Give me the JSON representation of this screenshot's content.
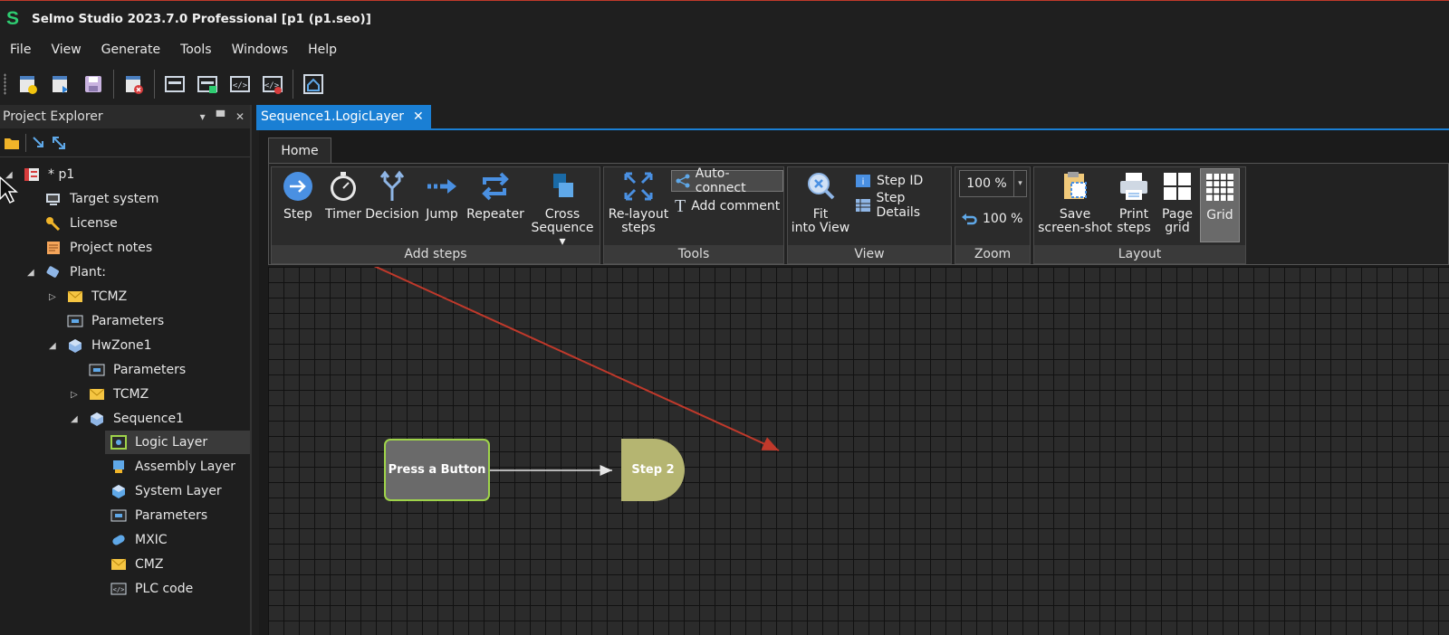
{
  "window": {
    "title": "Selmo Studio 2023.7.0 Professional  [p1 (p1.seo)]",
    "logo_text": "S"
  },
  "menu": [
    "File",
    "View",
    "Generate",
    "Tools",
    "Windows",
    "Help"
  ],
  "explorer": {
    "title": "Project Explorer",
    "tree": [
      {
        "label": "* p1",
        "icon": "project-icon",
        "expander": "◢"
      },
      {
        "label": "Target system",
        "icon": "target-system-icon",
        "expander": ""
      },
      {
        "label": "License",
        "icon": "key-icon",
        "expander": ""
      },
      {
        "label": "Project notes",
        "icon": "notes-icon",
        "expander": ""
      },
      {
        "label": "Plant:",
        "icon": "plant-icon",
        "expander": "◢"
      },
      {
        "label": "TCMZ",
        "icon": "envelope-icon",
        "expander": "▷"
      },
      {
        "label": "Parameters",
        "icon": "parameters-icon",
        "expander": ""
      },
      {
        "label": "HwZone1",
        "icon": "cube-icon",
        "expander": "◢"
      },
      {
        "label": "Parameters",
        "icon": "parameters-icon",
        "expander": ""
      },
      {
        "label": "TCMZ",
        "icon": "envelope-icon",
        "expander": "▷"
      },
      {
        "label": "Sequence1",
        "icon": "cube-icon",
        "expander": "◢"
      },
      {
        "label": "Logic Layer",
        "icon": "logic-layer-icon",
        "expander": ""
      },
      {
        "label": "Assembly Layer",
        "icon": "assembly-layer-icon",
        "expander": ""
      },
      {
        "label": "System Layer",
        "icon": "system-layer-icon",
        "expander": ""
      },
      {
        "label": "Parameters",
        "icon": "parameters-icon",
        "expander": ""
      },
      {
        "label": "MXIC",
        "icon": "mxic-icon",
        "expander": ""
      },
      {
        "label": "CMZ",
        "icon": "envelope-icon",
        "expander": ""
      },
      {
        "label": "PLC code",
        "icon": "code-icon",
        "expander": ""
      }
    ]
  },
  "document_tab": {
    "label": "Sequence1.LogicLayer",
    "close": "✕"
  },
  "ribbon": {
    "tab": "Home",
    "groups": {
      "add_steps": {
        "label": "Add steps",
        "step": "Step",
        "timer": "Timer",
        "decision": "Decision",
        "jump": "Jump",
        "repeater": "Repeater",
        "cross_line1": "Cross",
        "cross_line2": "Sequence ▾"
      },
      "tools": {
        "label": "Tools",
        "relayout_line1": "Re-layout",
        "relayout_line2": "steps",
        "auto_connect": "Auto-connect",
        "add_comment": "Add comment"
      },
      "view": {
        "label": "View",
        "fit_line1": "Fit",
        "fit_line2": "into View",
        "step_id": "Step ID",
        "step_details": "Step Details"
      },
      "zoom": {
        "label": "Zoom",
        "value": "100 %",
        "reset": "100 %"
      },
      "layout": {
        "label": "Layout",
        "save_line1": "Save",
        "save_line2": "screen-shot",
        "print_line1": "Print",
        "print_line2": "steps",
        "page_line1": "Page",
        "page_line2": "grid",
        "grid": "Grid"
      }
    }
  },
  "diagram": {
    "nodes": [
      {
        "id": "press",
        "label": "Press a Button"
      },
      {
        "id": "step2",
        "label": "Step 2"
      }
    ],
    "colors": {
      "accent": "#1a7fd4",
      "node_border": "#9fd44a",
      "step2_fill": "#b5b571",
      "annotation_arrow": "#c0392b"
    }
  }
}
